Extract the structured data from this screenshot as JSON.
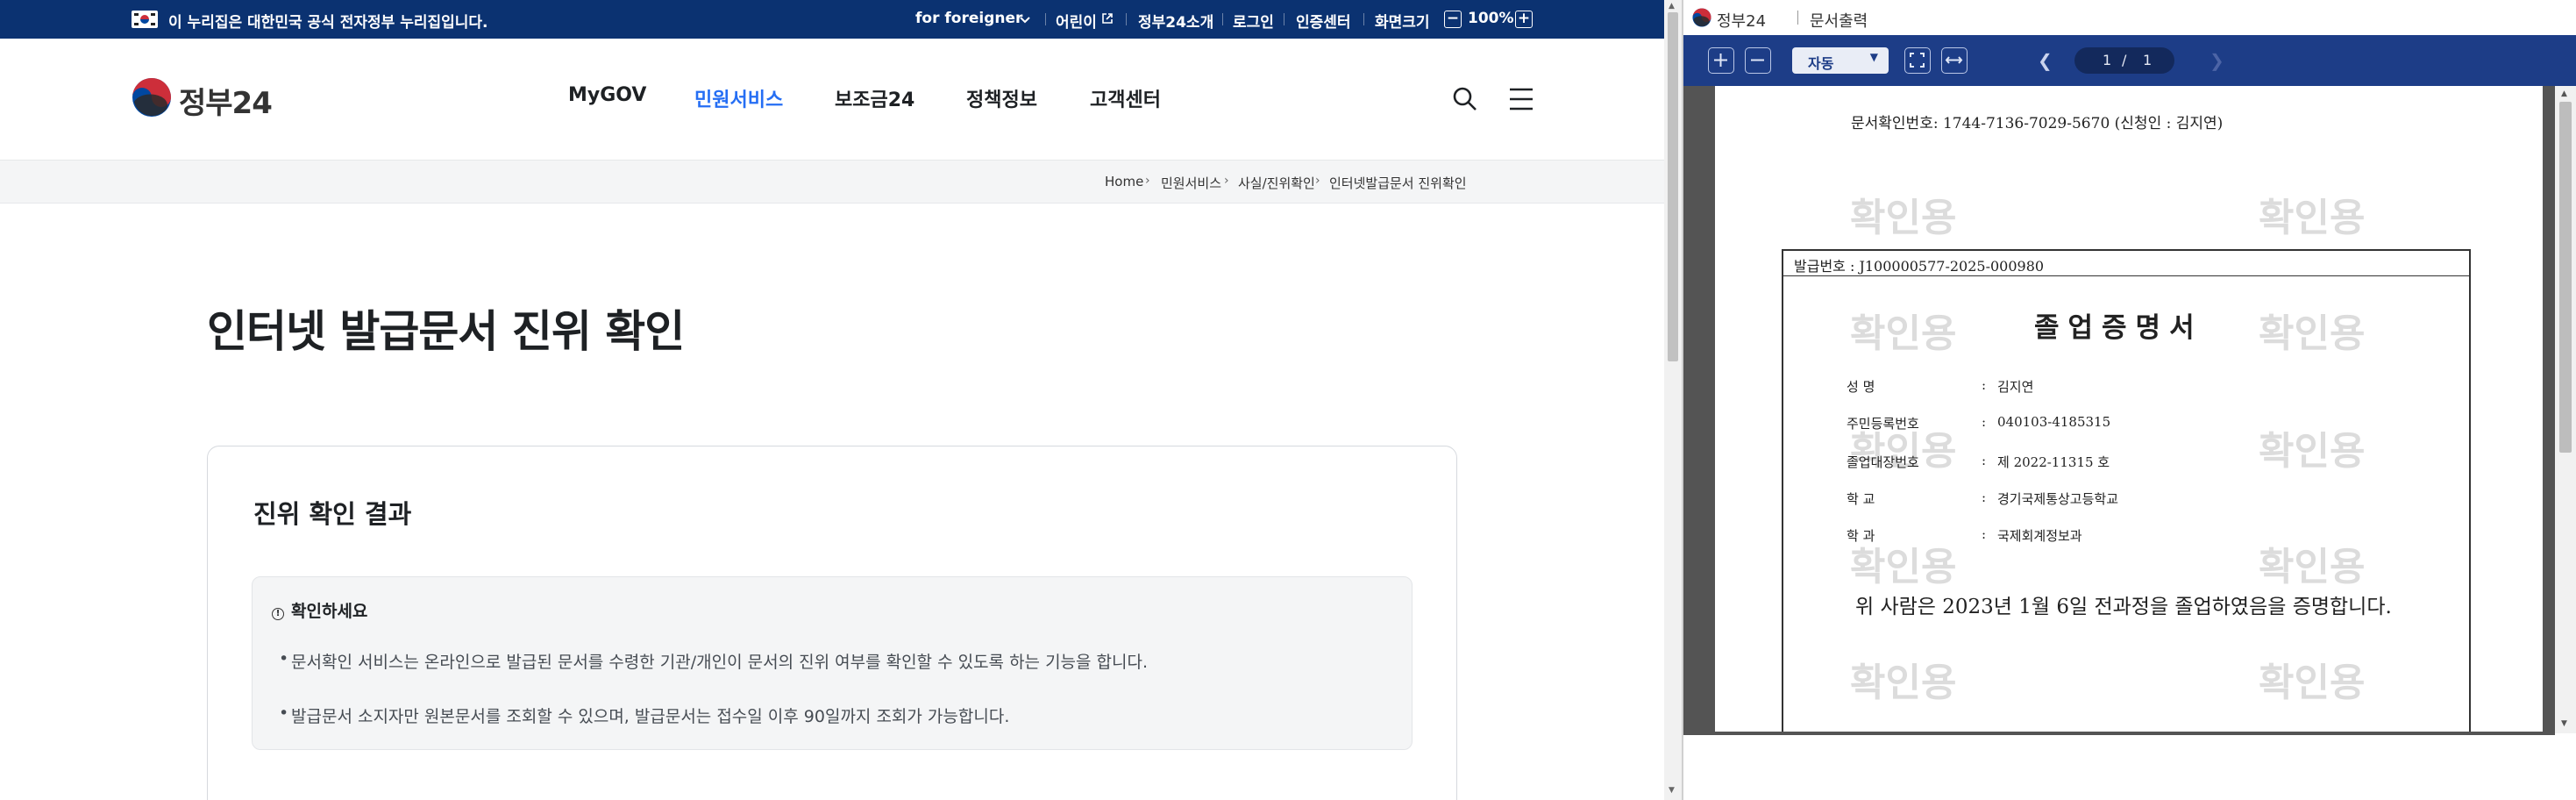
{
  "topbar": {
    "notice": "이 누리집은 대한민국 공식 전자정부 누리집입니다.",
    "foreigner": "for foreigner",
    "kids": "어린이",
    "about": "정부24소개",
    "login": "로그인",
    "cert_center": "인증센터",
    "screen_size_label": "화면크기",
    "zoom_minus": "−",
    "zoom_value": "100%",
    "zoom_plus": "+"
  },
  "header": {
    "logo_text": "정부24",
    "nav": [
      "MyGOV",
      "민원서비스",
      "보조금24",
      "정책정보",
      "고객센터"
    ],
    "active_nav": "민원서비스"
  },
  "breadcrumb": [
    "Home",
    "민원서비스",
    "사실/진위확인",
    "인터넷발급문서 진위확인"
  ],
  "main": {
    "title": "인터넷 발급문서 진위 확인",
    "result_title": "진위 확인 결과",
    "notice_heading": "확인하세요",
    "notice_items": [
      "문서확인 서비스는 온라인으로 발급된 문서를 수령한 기관/개인이 문서의 진위 여부를 확인할 수 있도록 하는 기능을 합니다.",
      "발급문서 소지자만 원본문서를 조회할 수 있으며, 발급문서는 접수일 이후 90일까지 조회가 가능합니다."
    ]
  },
  "viewer": {
    "app_name": "정부24",
    "window_title": "문서출력",
    "zoom_mode": "자동",
    "current_page": "1",
    "page_sep": "/",
    "total_pages": "1"
  },
  "document": {
    "confirm_line": "문서확인번호: 1744-7136-7029-5670 (신청인 : 김지연)",
    "watermark": "확인용",
    "issue_no": "발급번호 : J100000577-2025-000980",
    "title": "졸업증명서",
    "fields": [
      {
        "label": "성          명",
        "value": "김지연"
      },
      {
        "label": "주민등록번호",
        "value": "040103-4185315"
      },
      {
        "label": "졸업대장번호",
        "value": "제 2022-11315 호"
      },
      {
        "label": "학          교",
        "value": "경기국제통상고등학교"
      },
      {
        "label": "학          과",
        "value": "국제회계정보과"
      }
    ],
    "colon": ":",
    "statement": "위 사람은 2023년 1월 6일 전과정을 졸업하였음을 증명합니다."
  },
  "colors": {
    "topbar_bg": "#0b3271",
    "active_nav": "#256ef4",
    "viewer_toolbar": "#1d3d87",
    "logo_red": "#cd2e3a",
    "logo_blue": "#0047a0"
  },
  "icons": [
    "flag-icon",
    "chevron-down-icon",
    "external-link-icon",
    "search-icon",
    "hamburger-menu-icon",
    "info-icon",
    "zoom-in-icon",
    "zoom-out-icon",
    "fit-page-icon",
    "fit-width-icon",
    "prev-page-icon",
    "next-page-icon"
  ]
}
